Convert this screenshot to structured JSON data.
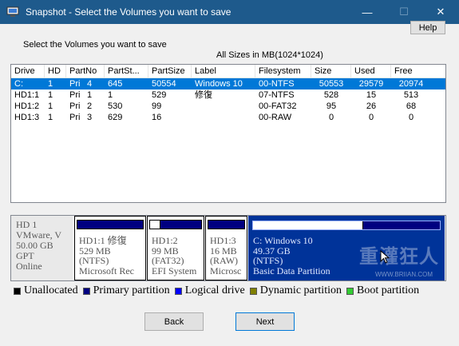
{
  "window": {
    "title": "Snapshot - Select the Volumes you want to save"
  },
  "help_label": "Help",
  "prompt": "Select the Volumes you want to save",
  "sizes_note": "All Sizes in MB(1024*1024)",
  "table": {
    "columns": [
      "Drive",
      "HD",
      "PartNo",
      "PartSt...",
      "PartSize",
      "Label",
      "Filesystem",
      "Size",
      "Used",
      "Free"
    ],
    "rows": [
      {
        "drive": "C:",
        "hd": "1",
        "type": "Pri",
        "no": "4",
        "start": "645",
        "psize": "50554",
        "label": "Windows 10",
        "fs": "00-NTFS",
        "size": "50553",
        "used": "29579",
        "free": "20974",
        "selected": true
      },
      {
        "drive": "HD1:1",
        "hd": "1",
        "type": "Pri",
        "no": "1",
        "start": "1",
        "psize": "529",
        "label": "修復",
        "fs": "07-NTFS",
        "size": "528",
        "used": "15",
        "free": "513"
      },
      {
        "drive": "HD1:2",
        "hd": "1",
        "type": "Pri",
        "no": "2",
        "start": "530",
        "psize": "99",
        "label": "",
        "fs": "00-FAT32",
        "size": "95",
        "used": "26",
        "free": "68"
      },
      {
        "drive": "HD1:3",
        "hd": "1",
        "type": "Pri",
        "no": "3",
        "start": "629",
        "psize": "16",
        "label": "",
        "fs": "00-RAW",
        "size": "0",
        "used": "0",
        "free": "0"
      }
    ]
  },
  "disk": {
    "l1": "HD 1",
    "l2": "VMware,  V",
    "l3": "50.00 GB",
    "l4": "GPT",
    "l5": "Online"
  },
  "partitions": [
    {
      "l1": "HD1:1 修復",
      "l2": "529 MB",
      "l3": "(NTFS)",
      "l4": "Microsoft Rec",
      "used_fraction": 0.0
    },
    {
      "l1": "HD1:2",
      "l2": "99 MB",
      "l3": "(FAT32)",
      "l4": "EFI System",
      "used_fraction": 0.2
    },
    {
      "l1": "HD1:3",
      "l2": "16 MB",
      "l3": "(RAW)",
      "l4": "Microsc",
      "used_fraction": 0.0
    },
    {
      "l1": "C: Windows 10",
      "l2": "49.37 GB",
      "l3": "(NTFS)",
      "l4": "Basic Data Partition",
      "used_fraction": 0.59
    }
  ],
  "watermark": {
    "text": "重灌狂人",
    "sub": "WWW.BRIIAN.COM"
  },
  "legend": [
    {
      "label": "Unallocated",
      "color": "#000000"
    },
    {
      "label": "Primary partition",
      "color": "#000080"
    },
    {
      "label": "Logical drive",
      "color": "#0000ff"
    },
    {
      "label": "Dynamic partition",
      "color": "#808000"
    },
    {
      "label": "Boot partition",
      "color": "#33cc33"
    }
  ],
  "buttons": {
    "back": "Back",
    "next": "Next"
  }
}
